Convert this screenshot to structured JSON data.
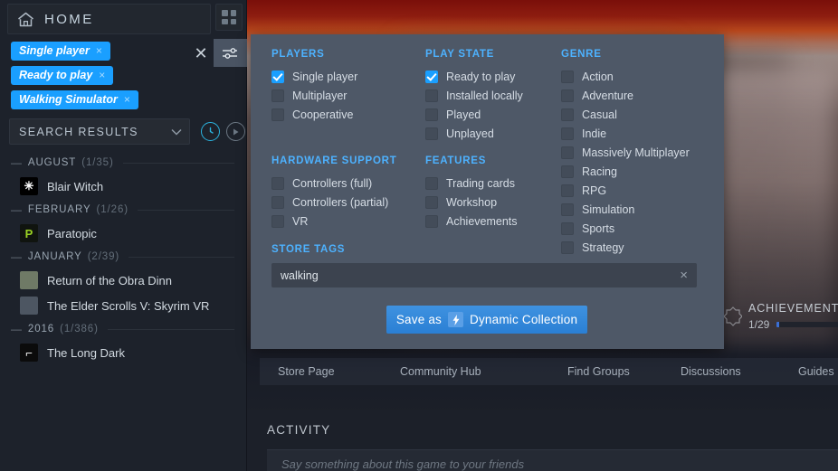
{
  "sidebar": {
    "home_label": "HOME",
    "home_icon": "home-icon",
    "grid_view_icon": "grid-view-icon",
    "clear_filters_icon": "close-icon",
    "filter_toggle_icon": "sliders-icon",
    "tags": [
      {
        "label": "Single player",
        "remove": "×"
      },
      {
        "label": "Ready to play",
        "remove": "×"
      },
      {
        "label": "Walking Simulator",
        "remove": "×"
      }
    ],
    "sort_select": {
      "value": "SEARCH RESULTS",
      "chevron": "⌄"
    },
    "recent_icon": "clock-icon",
    "play_icon": "play-circle-icon",
    "sections": [
      {
        "name": "AUGUST",
        "count": "(1/35)",
        "dash": "—",
        "games": [
          {
            "title": "Blair Witch",
            "icon_class": "ic-blairwitch",
            "glyph": "✳"
          }
        ]
      },
      {
        "name": "FEBRUARY",
        "count": "(1/26)",
        "dash": "—",
        "games": [
          {
            "title": "Paratopic",
            "icon_class": "ic-paratopic",
            "glyph": "P"
          }
        ]
      },
      {
        "name": "JANUARY",
        "count": "(2/39)",
        "dash": "—",
        "games": [
          {
            "title": "Return of the Obra Dinn",
            "icon_class": "ic-obradinn",
            "glyph": ""
          },
          {
            "title": "The Elder Scrolls V: Skyrim VR",
            "icon_class": "ic-skyrim",
            "glyph": ""
          }
        ]
      },
      {
        "name": "2016",
        "count": "(1/386)",
        "dash": "—",
        "games": [
          {
            "title": "The Long Dark",
            "icon_class": "ic-longdark",
            "glyph": "⌐"
          }
        ]
      }
    ]
  },
  "filter_panel": {
    "columns": [
      {
        "key": "players",
        "heading": "PLAYERS",
        "options": [
          {
            "label": "Single player",
            "checked": true
          },
          {
            "label": "Multiplayer",
            "checked": false
          },
          {
            "label": "Cooperative",
            "checked": false
          }
        ]
      },
      {
        "key": "hardware_support",
        "heading": "HARDWARE SUPPORT",
        "options": [
          {
            "label": "Controllers (full)",
            "checked": false
          },
          {
            "label": "Controllers (partial)",
            "checked": false
          },
          {
            "label": "VR",
            "checked": false
          }
        ]
      },
      {
        "key": "play_state",
        "heading": "PLAY STATE",
        "options": [
          {
            "label": "Ready to play",
            "checked": true
          },
          {
            "label": "Installed locally",
            "checked": false
          },
          {
            "label": "Played",
            "checked": false
          },
          {
            "label": "Unplayed",
            "checked": false
          }
        ]
      },
      {
        "key": "features",
        "heading": "FEATURES",
        "options": [
          {
            "label": "Trading cards",
            "checked": false
          },
          {
            "label": "Workshop",
            "checked": false
          },
          {
            "label": "Achievements",
            "checked": false
          }
        ]
      },
      {
        "key": "genre",
        "heading": "GENRE",
        "options": [
          {
            "label": "Action",
            "checked": false
          },
          {
            "label": "Adventure",
            "checked": false
          },
          {
            "label": "Casual",
            "checked": false
          },
          {
            "label": "Indie",
            "checked": false
          },
          {
            "label": "Massively Multiplayer",
            "checked": false
          },
          {
            "label": "Racing",
            "checked": false
          },
          {
            "label": "RPG",
            "checked": false
          },
          {
            "label": "Simulation",
            "checked": false
          },
          {
            "label": "Sports",
            "checked": false
          },
          {
            "label": "Strategy",
            "checked": false
          }
        ]
      }
    ],
    "store_tags_heading": "STORE TAGS",
    "store_tags_value": "walking",
    "store_tags_clear": "×",
    "save_button": {
      "prefix": "Save as",
      "suffix": "Dynamic Collection",
      "bolt": "⚡"
    }
  },
  "main": {
    "achievements": {
      "title": "ACHIEVEMENTS",
      "count": "1/29",
      "progress_percent": 3,
      "badge_icon": "achievement-badge-icon"
    },
    "tabs": [
      {
        "label": "Store Page"
      },
      {
        "label": "Community Hub"
      },
      {
        "label": "Find Groups"
      },
      {
        "label": "Discussions"
      },
      {
        "label": "Guides"
      }
    ],
    "activity_heading": "ACTIVITY",
    "activity_placeholder": "Say something about this game to your friends"
  },
  "colors": {
    "accent_blue": "#1a9fff",
    "heading_blue": "#4db2ff",
    "panel_bg": "#4e5867",
    "sidebar_bg": "#1d222b"
  }
}
